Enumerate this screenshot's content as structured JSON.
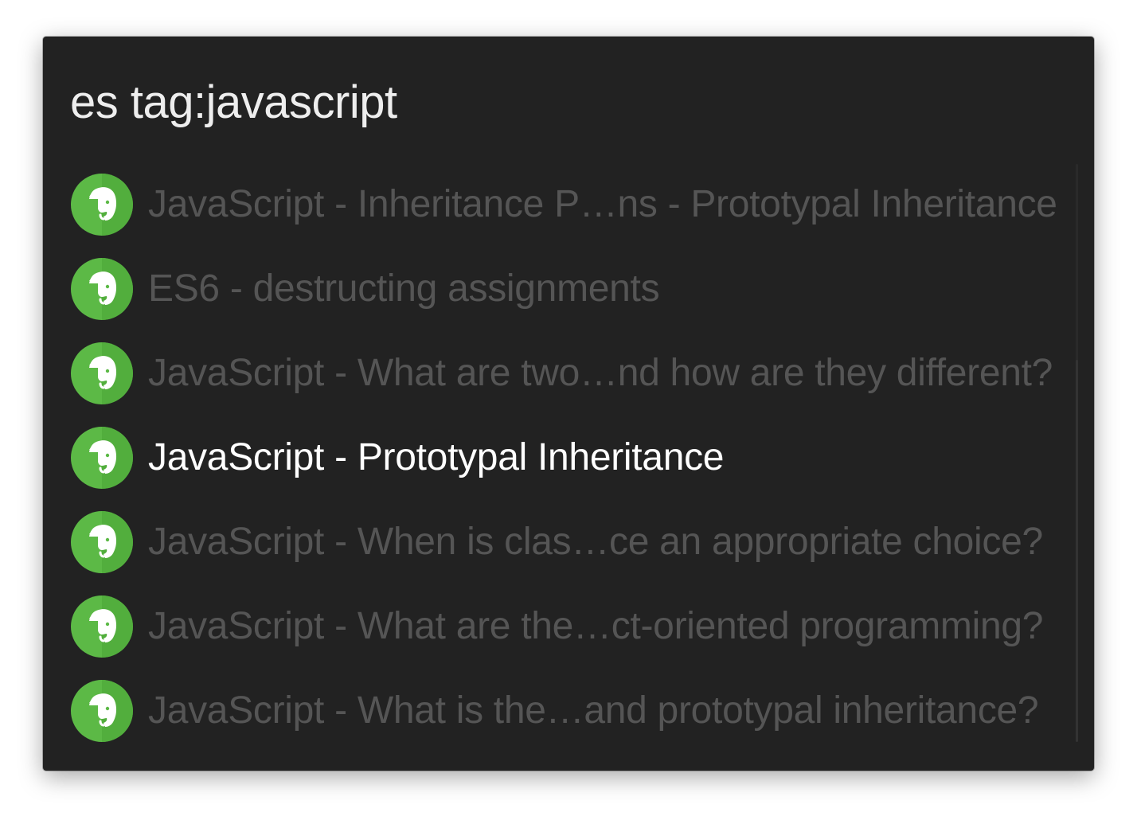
{
  "search": {
    "query": "es tag:javascript"
  },
  "results": [
    {
      "title": "JavaScript - Inheritance P…ns - Prototypal Inheritance",
      "icon": "evernote-icon",
      "selected": false
    },
    {
      "title": "ES6 - destructing assignments",
      "icon": "evernote-icon",
      "selected": false
    },
    {
      "title": "JavaScript - What are two…nd how are they different?",
      "icon": "evernote-icon",
      "selected": false
    },
    {
      "title": "JavaScript - Prototypal Inheritance",
      "icon": "evernote-icon",
      "selected": true
    },
    {
      "title": "JavaScript - When is clas…ce an appropriate choice?",
      "icon": "evernote-icon",
      "selected": false
    },
    {
      "title": "JavaScript - What are the…ct-oriented programming?",
      "icon": "evernote-icon",
      "selected": false
    },
    {
      "title": "JavaScript - What is the…and prototypal inheritance?",
      "icon": "evernote-icon",
      "selected": false
    }
  ],
  "colors": {
    "background": "#222222",
    "icon_green": "#5cb946",
    "icon_green_dark": "#4aa536",
    "selected_text": "#ffffff",
    "dim_text": "#555555"
  }
}
